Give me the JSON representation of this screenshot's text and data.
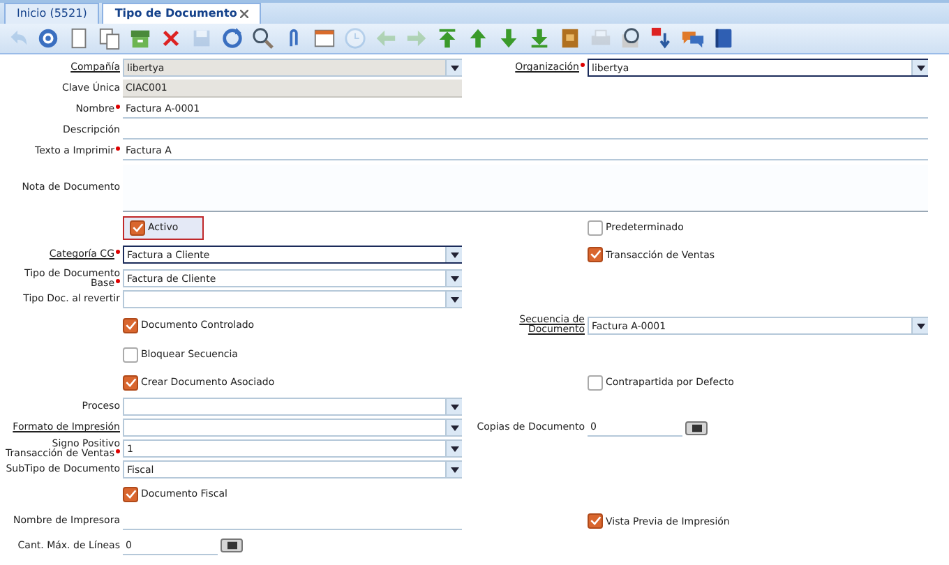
{
  "tabs": [
    {
      "label": "Inicio (5521)",
      "selected": false,
      "closable": false
    },
    {
      "label": "Tipo de Documento",
      "selected": true,
      "closable": true
    }
  ],
  "toolbar": [
    {
      "kind": "undo",
      "disabled": true
    },
    {
      "kind": "help",
      "disabled": false
    },
    {
      "kind": "new",
      "disabled": false
    },
    {
      "kind": "copy",
      "disabled": false
    },
    {
      "kind": "archive",
      "disabled": false
    },
    {
      "kind": "delete",
      "disabled": false
    },
    {
      "kind": "save",
      "disabled": true
    },
    {
      "kind": "refresh",
      "disabled": false
    },
    {
      "kind": "find",
      "disabled": false
    },
    {
      "kind": "attach",
      "disabled": false
    },
    {
      "kind": "window",
      "disabled": false
    },
    {
      "kind": "history",
      "disabled": true
    },
    {
      "kind": "left",
      "disabled": true
    },
    {
      "kind": "right",
      "disabled": true
    },
    {
      "kind": "first",
      "disabled": false
    },
    {
      "kind": "up",
      "disabled": false
    },
    {
      "kind": "down",
      "disabled": false
    },
    {
      "kind": "last",
      "disabled": false
    },
    {
      "kind": "report",
      "disabled": false
    },
    {
      "kind": "print",
      "disabled": true
    },
    {
      "kind": "zoom",
      "disabled": false
    },
    {
      "kind": "workflow",
      "disabled": false
    },
    {
      "kind": "chat",
      "disabled": false
    },
    {
      "kind": "book",
      "disabled": false
    }
  ],
  "rows": [
    {
      "left": {
        "kind": "select",
        "label": "Compañía",
        "link": true,
        "required": false,
        "readonly": true,
        "value": "libertya"
      },
      "right": {
        "kind": "select",
        "label": "Organización",
        "link": true,
        "required": true,
        "readonly": false,
        "value": "libertya"
      }
    },
    {
      "left": {
        "kind": "text",
        "label": "Clave Única",
        "link": false,
        "required": false,
        "readonly": true,
        "value": "CIAC001"
      }
    },
    {
      "left": {
        "kind": "text",
        "label": "Nombre",
        "link": false,
        "required": true,
        "readonly": false,
        "wide": true,
        "value": "Factura A-0001"
      }
    },
    {
      "left": {
        "kind": "text",
        "label": "Descripción",
        "link": false,
        "required": false,
        "readonly": false,
        "wide": true
      }
    },
    {
      "left": {
        "kind": "text",
        "label": "Texto a Imprimir",
        "link": false,
        "required": true,
        "readonly": false,
        "wide": true,
        "value": "Factura A"
      }
    },
    {
      "left": {
        "kind": "textarea",
        "label": "Nota de Documento",
        "link": false,
        "required": false,
        "wide": true
      }
    },
    {
      "left": {
        "kind": "checkbox",
        "label": "Activo",
        "checked": true,
        "focused": true
      },
      "right": {
        "kind": "checkbox",
        "label": "Predeterminado",
        "checked": false,
        "focused": false
      }
    },
    {
      "left": {
        "kind": "select",
        "label": "Categoría CG",
        "link": true,
        "required": true,
        "readonly": false,
        "value": "Factura a Cliente"
      },
      "right": {
        "kind": "checkbox",
        "label": "Transacción de Ventas",
        "checked": true,
        "focused": false
      }
    },
    {
      "left": {
        "kind": "select",
        "label": "Tipo de Documento Base",
        "link": false,
        "required": true,
        "readonly": false,
        "value": "Factura de Cliente"
      }
    },
    {
      "left": {
        "kind": "select",
        "label": "Tipo Doc. al revertir",
        "link": false,
        "required": false,
        "readonly": false
      }
    },
    {
      "left": {
        "kind": "checkbox",
        "label": "Documento Controlado",
        "checked": true,
        "focused": false
      },
      "right": {
        "kind": "select",
        "label": "Secuencia de Documento",
        "link": true,
        "required": false,
        "readonly": false,
        "value": "Factura A-0001"
      }
    },
    {
      "left": {
        "kind": "checkbox",
        "label": "Bloquear Secuencia",
        "checked": false,
        "focused": false
      }
    },
    {
      "left": {
        "kind": "checkbox",
        "label": "Crear Documento Asociado",
        "checked": true,
        "focused": false
      },
      "right": {
        "kind": "checkbox",
        "label": "Contrapartida por Defecto",
        "checked": false,
        "focused": false
      }
    },
    {
      "left": {
        "kind": "select",
        "label": "Proceso",
        "link": false,
        "required": false,
        "readonly": false
      }
    },
    {
      "left": {
        "kind": "select",
        "label": "Formato de Impresión",
        "link": true,
        "required": false,
        "readonly": false
      },
      "right": {
        "kind": "number",
        "label": "Copias de Documento",
        "link": false,
        "required": false,
        "readonly": false,
        "value": "0"
      }
    },
    {
      "left": {
        "kind": "select",
        "label": "Signo Positivo Transacción de Ventas",
        "link": false,
        "required": true,
        "readonly": false,
        "value": "1"
      }
    },
    {
      "left": {
        "kind": "select",
        "label": "SubTipo de Documento",
        "link": false,
        "required": false,
        "readonly": false,
        "value": "Fiscal"
      }
    },
    {
      "left": {
        "kind": "checkbox",
        "label": "Documento Fiscal",
        "checked": true,
        "focused": false
      }
    },
    {
      "left": {
        "kind": "text",
        "label": "Nombre de Impresora",
        "link": false,
        "required": false,
        "readonly": false
      },
      "right": {
        "kind": "checkbox",
        "label": "Vista Previa de Impresión",
        "checked": true,
        "focused": false
      }
    },
    {
      "left": {
        "kind": "number",
        "label": "Cant. Máx. de Líneas",
        "link": false,
        "required": false,
        "readonly": false,
        "value": "0"
      }
    }
  ]
}
